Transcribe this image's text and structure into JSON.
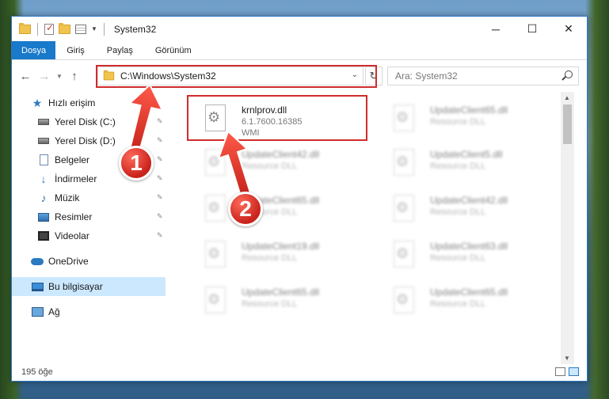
{
  "window": {
    "title": "System32",
    "controls": {
      "minimize": "─",
      "maximize": "☐",
      "close": "✕"
    }
  },
  "ribbon": {
    "tabs": [
      "Dosya",
      "Giriş",
      "Paylaş",
      "Görünüm"
    ]
  },
  "address": {
    "path": "C:\\Windows\\System32",
    "search_placeholder": "Ara: System32"
  },
  "nav": {
    "quick_access": "Hızlı erişim",
    "pinned": [
      {
        "label": "Yerel Disk (C:)",
        "icon": "disk-icon"
      },
      {
        "label": "Yerel Disk (D:)",
        "icon": "disk-icon"
      },
      {
        "label": "Belgeler",
        "icon": "documents-icon"
      },
      {
        "label": "İndirmeler",
        "icon": "downloads-icon"
      },
      {
        "label": "Müzik",
        "icon": "music-icon"
      },
      {
        "label": "Resimler",
        "icon": "pictures-icon"
      },
      {
        "label": "Videolar",
        "icon": "videos-icon"
      }
    ],
    "onedrive": "OneDrive",
    "this_pc": "Bu bilgisayar",
    "network": "Ağ"
  },
  "files": {
    "focus": {
      "name": "krnlprov.dll",
      "version": "6.1.7600.16385",
      "desc": "WMI"
    },
    "left_column": [
      {
        "name": "UpdateClient42.dll",
        "desc": "Resource DLL"
      },
      {
        "name": "UpdateClient65.dll",
        "desc": "Resource DLL"
      },
      {
        "name": "UpdateClient19.dll",
        "desc": "Resource DLL"
      },
      {
        "name": "UpdateClient65.dll",
        "desc": "Resource DLL"
      }
    ],
    "right_column": [
      {
        "name": "UpdateClient65.dll",
        "desc": "Resource DLL"
      },
      {
        "name": "UpdateClient5.dll",
        "desc": "Resource DLL"
      },
      {
        "name": "UpdateClient42.dll",
        "desc": "Resource DLL"
      },
      {
        "name": "UpdateClient63.dll",
        "desc": "Resource DLL"
      },
      {
        "name": "UpdateClient65.dll",
        "desc": "Resource DLL"
      }
    ]
  },
  "status": {
    "count": "195 öğe"
  },
  "annotations": {
    "step1": "1",
    "step2": "2",
    "highlight_color": "#d02c2c"
  }
}
